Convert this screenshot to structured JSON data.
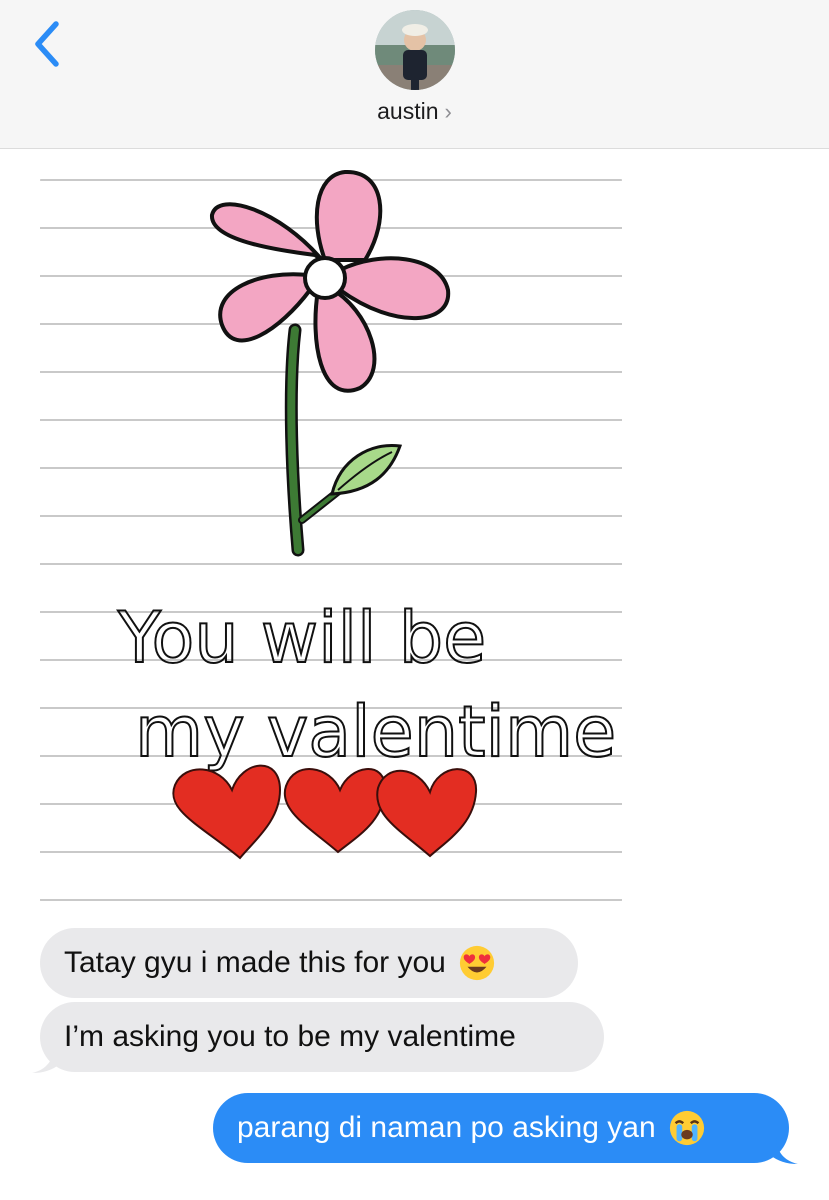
{
  "header": {
    "contact_name": "austin",
    "chevron": "›",
    "back_icon": "chevron-left-icon",
    "accent_color": "#2b8cf6"
  },
  "image_message": {
    "description_text_line1": "You will be",
    "description_text_line2": "my valentime"
  },
  "messages": [
    {
      "direction": "incoming",
      "text": "Tatay gyu i made this for you",
      "emoji": "heart-eyes-emoji"
    },
    {
      "direction": "incoming",
      "text": "I’m asking you to be my valentime"
    },
    {
      "direction": "outgoing",
      "text": "parang di naman po asking yan",
      "emoji": "loudly-crying-emoji"
    }
  ],
  "colors": {
    "incoming_bubble": "#e9e9eb",
    "outgoing_bubble": "#2b8cf6",
    "petal_pink": "#f3a6c3",
    "heart_red": "#e32d22",
    "leaf_green": "#a8d98a",
    "stem_green": "#3d7a34"
  }
}
